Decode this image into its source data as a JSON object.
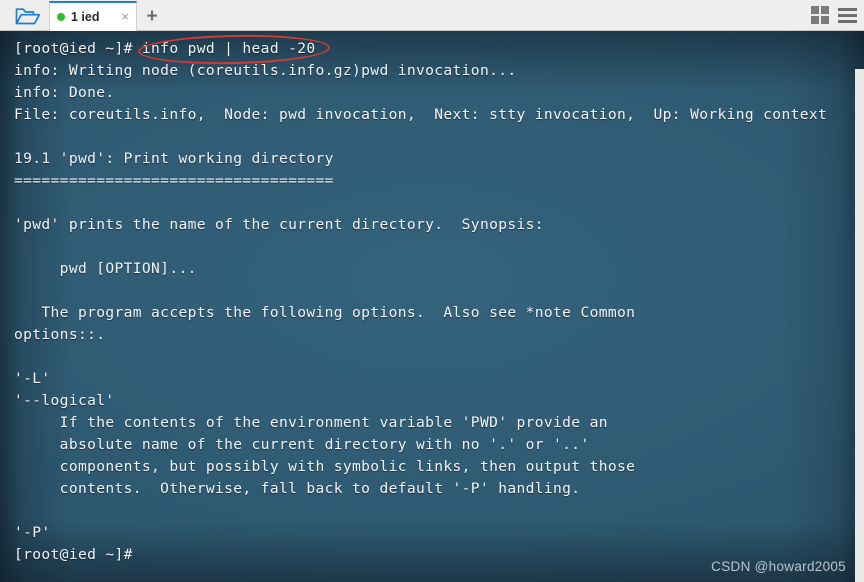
{
  "window": {
    "background_color": "#2d576f",
    "chrome_color": "#eeeeed"
  },
  "tabbar": {
    "folder_icon": "folder-open-icon",
    "tabs": [
      {
        "label": "1 ied",
        "status_dot_color": "#2fc12f",
        "close_label": "×",
        "active": true
      }
    ],
    "new_tab_label": "+",
    "grid_view_icon": "grid-view-icon",
    "menu_icon": "hamburger-menu-icon"
  },
  "terminal": {
    "lines": [
      "[root@ied ~]# info pwd | head -20",
      "info: Writing node (coreutils.info.gz)pwd invocation...",
      "info: Done.",
      "File: coreutils.info,  Node: pwd invocation,  Next: stty invocation,  Up: Working context",
      "",
      "19.1 'pwd': Print working directory",
      "===================================",
      "",
      "'pwd' prints the name of the current directory.  Synopsis:",
      "",
      "     pwd [OPTION]...",
      "",
      "   The program accepts the following options.  Also see *note Common",
      "options::.",
      "",
      "'-L'",
      "'--logical'",
      "     If the contents of the environment variable 'PWD' provide an",
      "     absolute name of the current directory with no '.' or '..'",
      "     components, but possibly with symbolic links, then output those",
      "     contents.  Otherwise, fall back to default '-P' handling.",
      "",
      "'-P'",
      "[root@ied ~]#"
    ],
    "annotation": {
      "type": "ellipse",
      "color": "#d33a33",
      "targets_text": "info pwd | head -20"
    },
    "watermark": "CSDN @howard2005"
  }
}
